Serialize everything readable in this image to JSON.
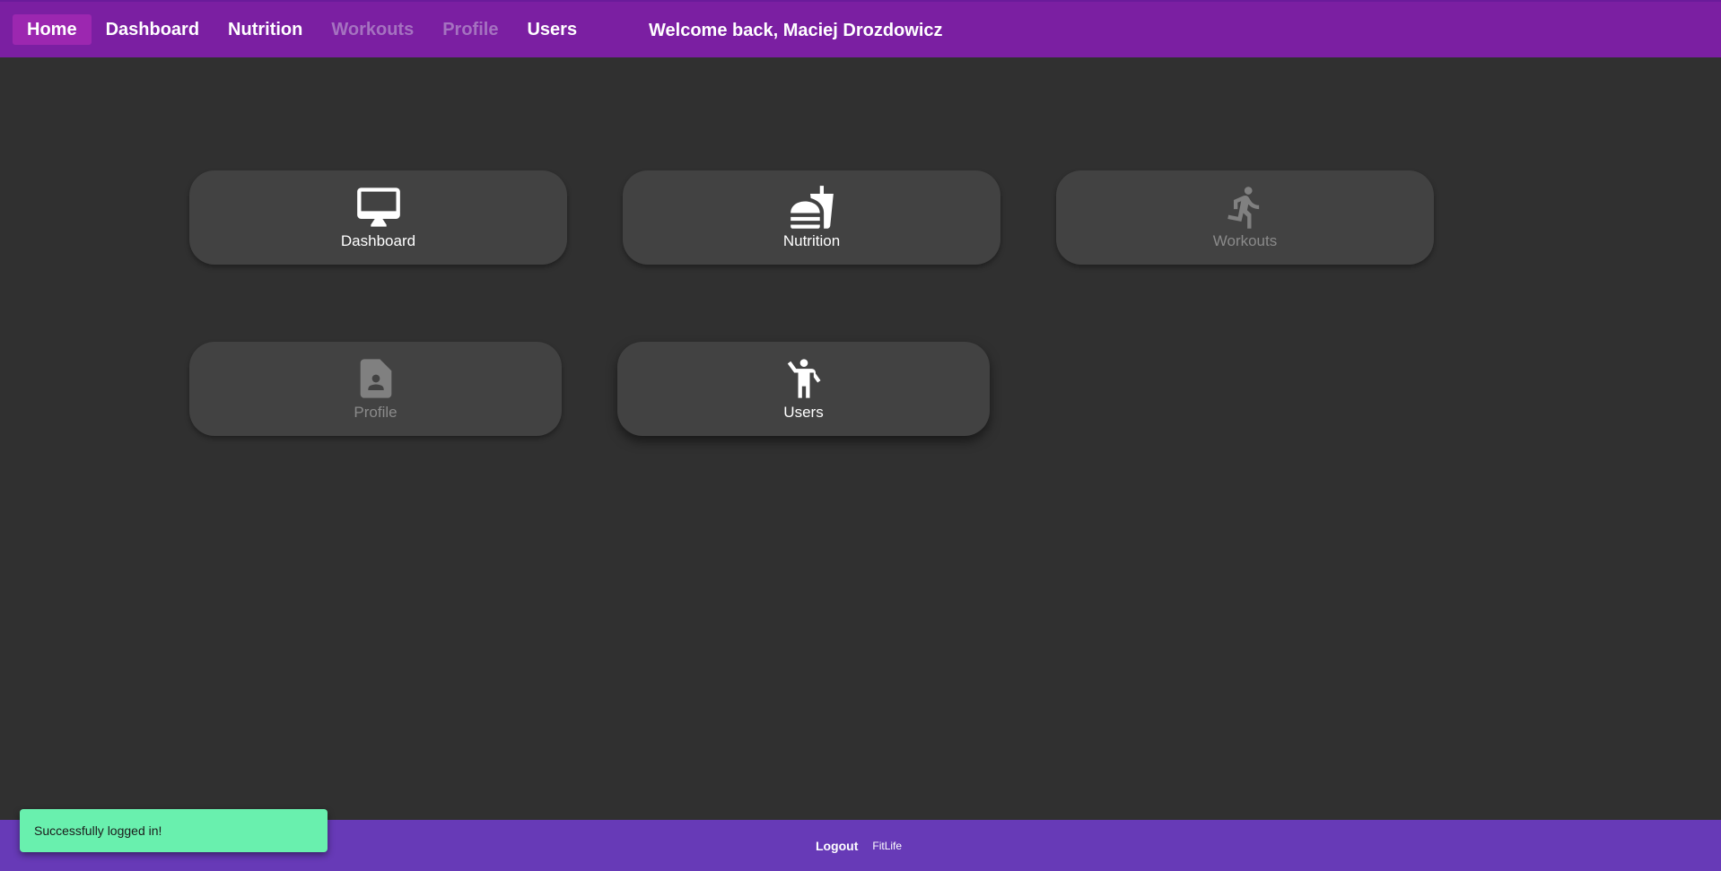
{
  "nav": {
    "items": [
      {
        "label": "Home",
        "state": "active"
      },
      {
        "label": "Dashboard",
        "state": "enabled"
      },
      {
        "label": "Nutrition",
        "state": "enabled"
      },
      {
        "label": "Workouts",
        "state": "disabled"
      },
      {
        "label": "Profile",
        "state": "disabled"
      },
      {
        "label": "Users",
        "state": "enabled"
      }
    ],
    "welcome": "Welcome back, Maciej Drozdowicz"
  },
  "tiles": [
    {
      "label": "Dashboard",
      "icon": "desktop-icon",
      "state": "enabled"
    },
    {
      "label": "Nutrition",
      "icon": "fastfood-icon",
      "state": "enabled"
    },
    {
      "label": "Workouts",
      "icon": "running-person-icon",
      "state": "disabled"
    },
    {
      "label": "Profile",
      "icon": "contact-file-icon",
      "state": "disabled"
    },
    {
      "label": "Users",
      "icon": "waving-person-icon",
      "state": "enabled"
    }
  ],
  "footer": {
    "logout": "Logout",
    "brand": "FitLife"
  },
  "snackbar": {
    "message": "Successfully logged in!"
  },
  "colors": {
    "topbar": "#7b1fa2",
    "active_nav": "#9c27b0",
    "background": "#303030",
    "tile": "#424242",
    "footer": "#673ab7",
    "snackbar": "#69f0ae"
  }
}
